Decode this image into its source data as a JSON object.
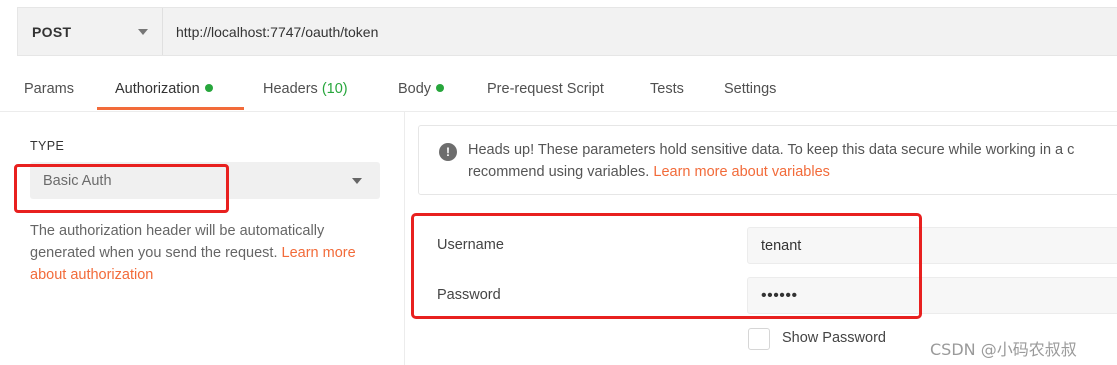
{
  "request": {
    "method": "POST",
    "url": "http://localhost:7747/oauth/token"
  },
  "tabs": [
    {
      "label": "Params"
    },
    {
      "label": "Authorization",
      "indicator": "green-dot"
    },
    {
      "label": "Headers",
      "count": "(10)"
    },
    {
      "label": "Body",
      "indicator": "green-dot"
    },
    {
      "label": "Pre-request Script"
    },
    {
      "label": "Tests"
    },
    {
      "label": "Settings"
    }
  ],
  "active_tab": "Authorization",
  "auth": {
    "type_label": "TYPE",
    "type_value": "Basic Auth",
    "description": "The authorization header will be automatically generated when you send the request.",
    "description_link": "Learn more about authorization"
  },
  "notice": {
    "text": "Heads up! These parameters hold sensitive data. To keep this data secure while working in a c",
    "text2": "recommend using variables.",
    "link": "Learn more about variables"
  },
  "fields": {
    "username_label": "Username",
    "username_value": "tenant",
    "password_label": "Password",
    "password_value": "••••••",
    "show_password_label": "Show Password"
  },
  "watermark": "CSDN @小码农叔叔",
  "colors": {
    "accent": "#f26b3a",
    "status_green": "#27a63c",
    "highlight_red": "#e8201f"
  }
}
